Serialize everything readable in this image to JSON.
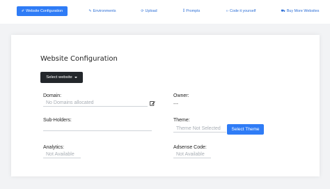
{
  "nav": {
    "tabs": [
      {
        "label": "Website Configuration",
        "icon": "✐"
      },
      {
        "label": "Environments",
        "icon": "✎"
      },
      {
        "label": "Upload",
        "icon": "⟳"
      },
      {
        "label": "Prompts",
        "icon": "⁑"
      },
      {
        "label": "Code it yourself",
        "icon": "‹›"
      },
      {
        "label": "Buy More Websites",
        "icon": "⛟"
      }
    ]
  },
  "card": {
    "title": "Website Configuration",
    "select_website": "Select website",
    "domain": {
      "label": "Domain:",
      "value": "No Domains allocated"
    },
    "owner": {
      "label": "Owner:",
      "value": "---"
    },
    "sub_holders": {
      "label": "Sub-Holders:",
      "value": ""
    },
    "theme": {
      "label": "Theme:",
      "value": "Theme Not Selected",
      "button": "Select Theme"
    },
    "analytics": {
      "label": "Analytics:",
      "value": "Not Available"
    },
    "adsense": {
      "label": "Adsense Code:",
      "value": "Not Available"
    }
  },
  "colors": {
    "accent": "#2f7cf6",
    "dark_button": "#23272b",
    "background": "#f2f3f5"
  }
}
